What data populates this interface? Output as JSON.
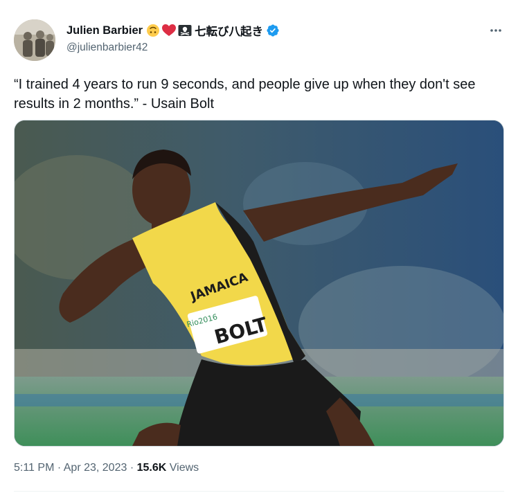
{
  "author": {
    "display_name": "Julien Barbier",
    "name_suffix": "七転び八起き",
    "handle": "@julienbarbier42",
    "verified": true,
    "name_icons": [
      "upside-down-face-icon",
      "red-heart-icon",
      "pirate-flag-icon"
    ]
  },
  "tweet": {
    "text": "“I trained 4 years to run 9 seconds, and people give up when they don't see results in 2 months.” - Usain Bolt"
  },
  "media": {
    "bib_name": "BOLT",
    "jersey_text": "JAMAICA",
    "event_logo_text": "Rio2016"
  },
  "meta": {
    "time": "5:11 PM",
    "separator": "·",
    "date": "Apr 23, 2023",
    "views_count": "15.6K",
    "views_label": "Views"
  },
  "colors": {
    "verified_blue": "#1d9bf0",
    "text_primary": "#0f1419",
    "text_secondary": "#536471",
    "border": "#cfd9de"
  }
}
